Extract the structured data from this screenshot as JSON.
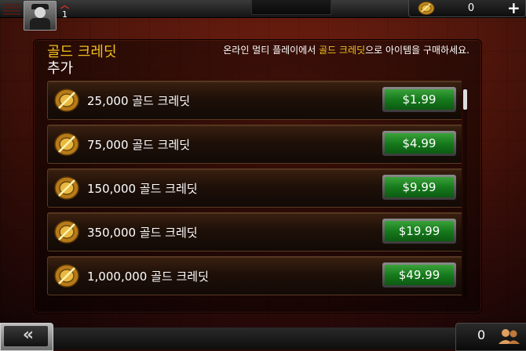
{
  "header": {
    "rank_level": "1",
    "gold_amount": "0",
    "add_gold_label": "+"
  },
  "panel": {
    "title_line1": "골드 크레딧",
    "title_line2": "추가",
    "description_part1": "온라인 멀티 플레이에서 ",
    "description_highlight": "골드 크레딧",
    "description_part2": "으로 아이템을 구매하세요."
  },
  "offers": [
    {
      "label": "25,000 골드 크레딧",
      "price": "$1.99"
    },
    {
      "label": "75,000 골드 크레딧",
      "price": "$4.99"
    },
    {
      "label": "150,000 골드 크레딧",
      "price": "$9.99"
    },
    {
      "label": "350,000 골드 크레딧",
      "price": "$19.99"
    },
    {
      "label": "1,000,000 골드 크레딧",
      "price": "$49.99"
    }
  ],
  "footer": {
    "back_label": "«",
    "friends_count": "0"
  },
  "colors": {
    "accent_gold": "#f0c020",
    "buy_green": "#1e8a24"
  },
  "icons": {
    "coin": "gold-coin-icon",
    "friends": "friends-icon",
    "back": "double-chevron-left-icon"
  }
}
